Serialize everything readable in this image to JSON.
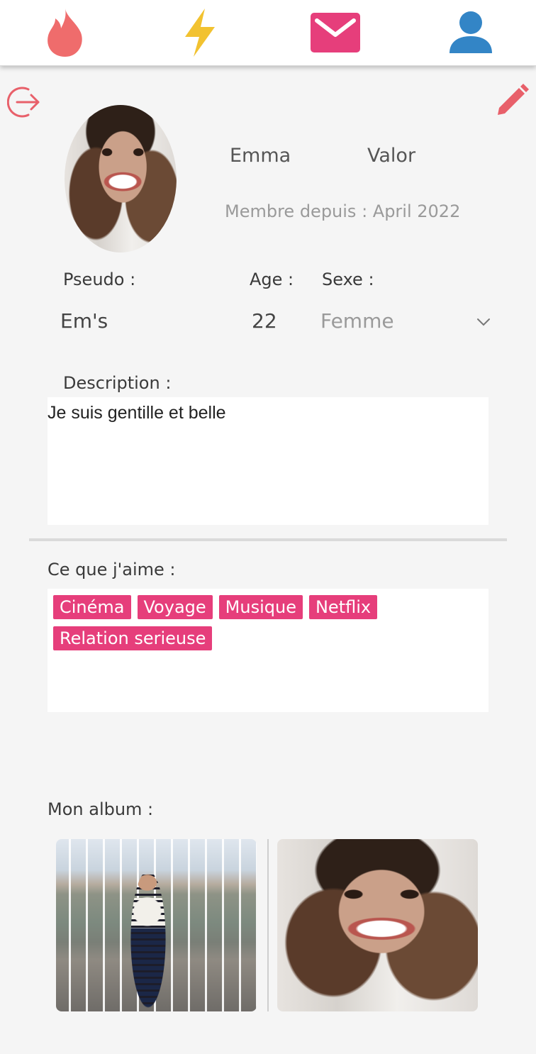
{
  "nav": {
    "items": [
      {
        "icon": "flame-icon",
        "color": "#ef6c6c"
      },
      {
        "icon": "lightning-icon",
        "color": "#f2c230"
      },
      {
        "icon": "mail-icon",
        "color": "#e63e7b"
      },
      {
        "icon": "user-icon",
        "color": "#3385c6"
      }
    ]
  },
  "profile": {
    "first_name": "Emma",
    "last_name": "Valor",
    "member_since": "Membre depuis : April 2022",
    "pseudo_label": "Pseudo :",
    "pseudo_value": "Em's",
    "age_label": "Age :",
    "age_value": "22",
    "sexe_label": "Sexe :",
    "sexe_value": "Femme",
    "description_label": "Description :",
    "description_value": "Je suis gentille et belle"
  },
  "likes": {
    "label": "Ce que j'aime :",
    "tags": [
      "Cinéma",
      "Voyage",
      "Musique",
      "Netflix",
      "Relation serieuse"
    ]
  },
  "album": {
    "label": "Mon album :"
  },
  "colors": {
    "accent": "#e63e7b",
    "logout": "#e8606a",
    "edit": "#e8606a",
    "background": "#f5f5f5"
  }
}
